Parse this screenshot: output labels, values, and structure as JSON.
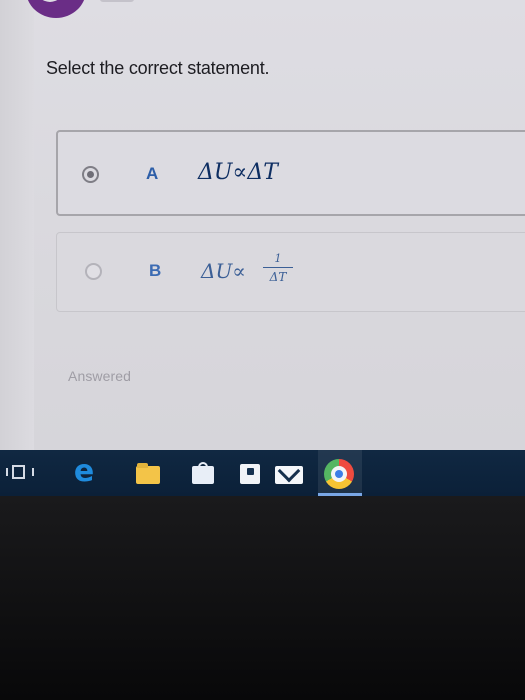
{
  "question": "Select the correct statement.",
  "options": [
    {
      "letter": "A",
      "expression": "ΔU∝ΔT",
      "selected": true
    },
    {
      "letter": "B",
      "expression_prefix": "ΔU∝",
      "numerator": "1",
      "denominator": "ΔT",
      "selected": false
    }
  ],
  "status_text": "Answered",
  "colors": {
    "logo": "#6a2d86",
    "option_letter": "#2d5ea8",
    "math": "#0e2e62",
    "taskbar": "#102842"
  },
  "taskbar_icons": [
    "task-view-icon",
    "edge-icon",
    "file-explorer-icon",
    "store-icon",
    "bag-icon",
    "mail-icon",
    "chrome-icon"
  ],
  "taskbar_active": "chrome-icon"
}
